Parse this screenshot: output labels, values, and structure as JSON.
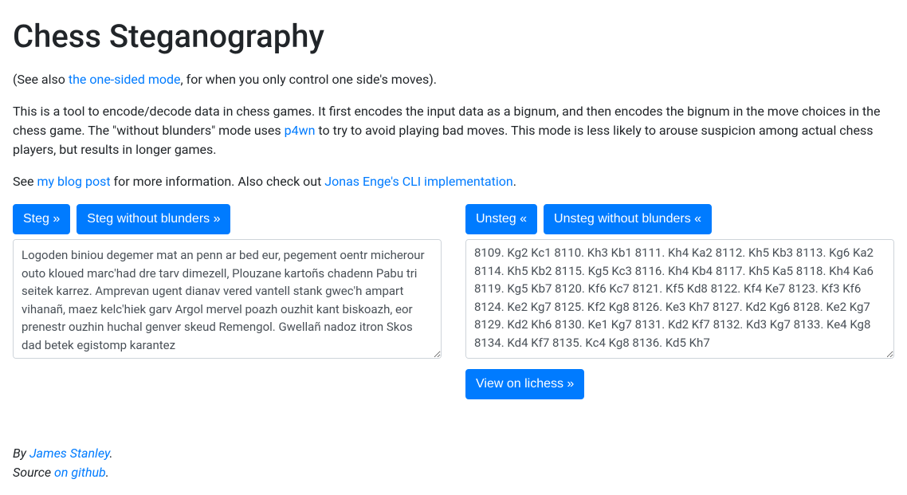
{
  "title": "Chess Steganography",
  "intro": {
    "see_also_prefix": "(See also ",
    "one_sided_link": "the one-sided mode",
    "see_also_suffix": ", for when you only control one side's moves).",
    "desc_prefix": "This is a tool to encode/decode data in chess games. It first encodes the input data as a bignum, and then encodes the bignum in the move choices in the chess game. The \"without blunders\" mode uses ",
    "p4wn_link": "p4wn",
    "desc_suffix": " to try to avoid playing bad moves. This mode is less likely to arouse suspicion among actual chess players, but results in longer games.",
    "see_prefix": "See ",
    "blog_link": "my blog post",
    "see_mid": " for more information. Also check out ",
    "jonas_link": "Jonas Enge's CLI implementation",
    "see_suffix": "."
  },
  "buttons": {
    "steg": "Steg »",
    "steg_no_blunders": "Steg without blunders »",
    "unsteg": "Unsteg «",
    "unsteg_no_blunders": "Unsteg without blunders «",
    "view_lichess": "View on lichess »"
  },
  "textareas": {
    "input_text": "Logoden biniou degemer mat an penn ar bed eur, pegement oentr micherour outo kloued marc'had dre tarv dimezell, Plouzane kartoñs chadenn Pabu tri seitek karrez. Amprevan ugent dianav vered vantell stank gwec'h ampart vihanañ, maez kelc'hiek garv Argol mervel poazh ouzhit kant biskoazh, eor prenestr ouzhin huchal genver skeud Remengol. Gwellañ nadoz itron Skos dad betek egistomp karantez",
    "pgn_text": "8109. Kg2 Kc1 8110. Kh3 Kb1 8111. Kh4 Ka2 8112. Kh5 Kb3 8113. Kg6 Ka2 8114. Kh5 Kb2 8115. Kg5 Kc3 8116. Kh4 Kb4 8117. Kh5 Ka5 8118. Kh4 Ka6 8119. Kg5 Kb7 8120. Kf6 Kc7 8121. Kf5 Kd8 8122. Kf4 Ke7 8123. Kf3 Kf6 8124. Ke2 Kg7 8125. Kf2 Kg8 8126. Ke3 Kh7 8127. Kd2 Kg6 8128. Ke2 Kg7 8129. Kd2 Kh6 8130. Ke1 Kg7 8131. Kd2 Kf7 8132. Kd3 Kg7 8133. Ke4 Kg8 8134. Kd4 Kf7 8135. Kc4 Kg8 8136. Kd5 Kh7"
  },
  "footer": {
    "by_prefix": "By ",
    "author_link": "James Stanley",
    "by_suffix": ".",
    "source_prefix": "Source ",
    "github_link": "on github",
    "source_suffix": "."
  }
}
